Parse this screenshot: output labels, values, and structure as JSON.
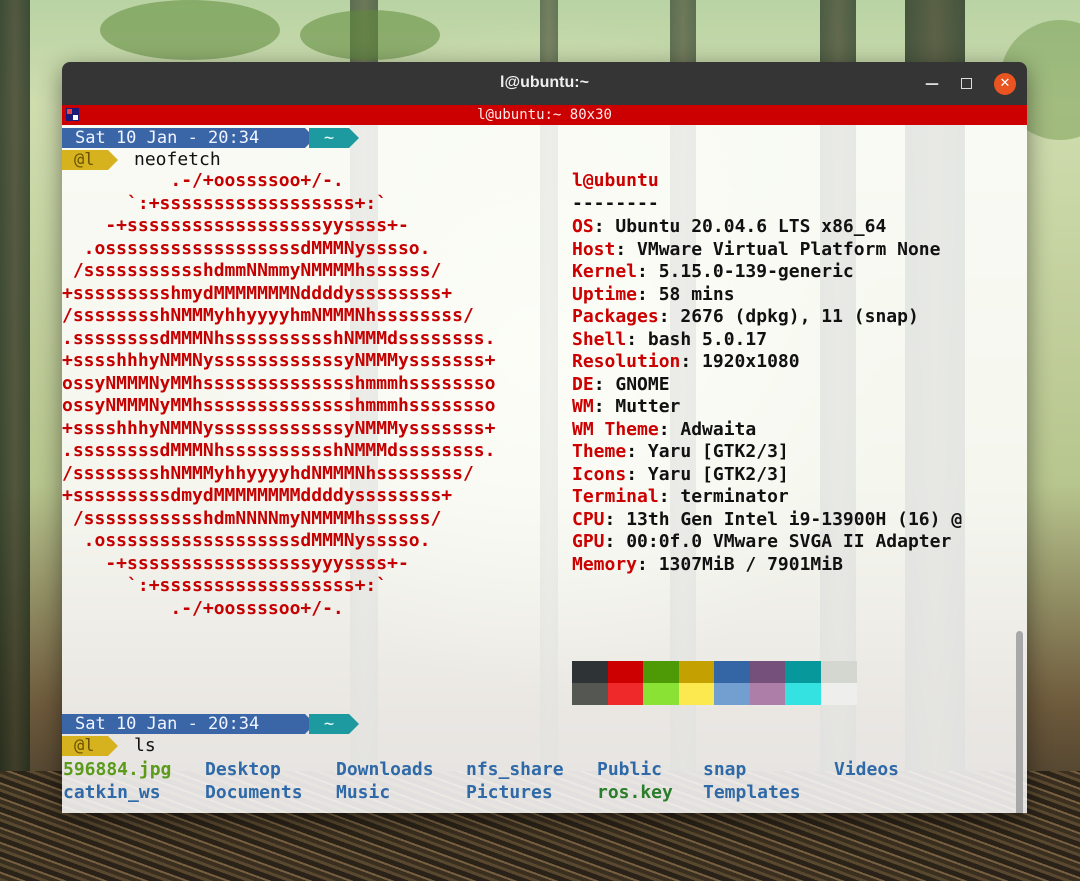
{
  "window": {
    "title": "l@ubuntu:~"
  },
  "terminal": {
    "title": "l@ubuntu:~ 80x30"
  },
  "prompt1": {
    "date": "Sat 10 Jan - 20:34",
    "dir": "~",
    "user": "@l",
    "command": "neofetch"
  },
  "prompt2": {
    "date": "Sat 10 Jan - 20:34",
    "dir": "~",
    "user": "@l",
    "command": "ls"
  },
  "logo_lines": [
    "          .-/+oossssoo+/-.",
    "      `:+ssssssssssssssssss+:`",
    "    -+ssssssssssssssssssyyssss+-",
    "  .ossssssssssssssssssdMMMNysssso.",
    " /ssssssssssshdmmNNmmyNMMMMhssssss/",
    "+ssssssssshmydMMMMMMMNddddyssssssss+",
    "/sssssssshNMMMyhhyyyyhmNMMMNhssssssss/",
    ".ssssssssdMMMNhsssssssssshNMMMdssssssss.",
    "+sssshhhyNMMNyssssssssssssyNMMMysssssss+",
    "ossyNMMMNyMMhsssssssssssssshmmmhssssssso",
    "ossyNMMMNyMMhsssssssssssssshmmmhssssssso",
    "+sssshhhyNMMNyssssssssssssyNMMMysssssss+",
    ".ssssssssdMMMNhsssssssssshNMMMdssssssss.",
    "/sssssssshNMMMyhhyyyyhdNMMMNhssssssss/",
    "+sssssssssdmydMMMMMMMMddddyssssssss+",
    " /ssssssssssshdmNNNNmyNMMMMhssssss/",
    "  .ossssssssssssssssssdMMMNysssso.",
    "    -+sssssssssssssssssyyyssss+-",
    "      `:+ssssssssssssssssss+:`",
    "          .-/+oossssoo+/-."
  ],
  "info": {
    "user_host": "l@ubuntu",
    "separator": "--------",
    "rows": [
      {
        "key": "OS",
        "value": "Ubuntu 20.04.6 LTS x86_64"
      },
      {
        "key": "Host",
        "value": "VMware Virtual Platform None"
      },
      {
        "key": "Kernel",
        "value": "5.15.0-139-generic"
      },
      {
        "key": "Uptime",
        "value": "58 mins"
      },
      {
        "key": "Packages",
        "value": "2676 (dpkg), 11 (snap)"
      },
      {
        "key": "Shell",
        "value": "bash 5.0.17"
      },
      {
        "key": "Resolution",
        "value": "1920x1080"
      },
      {
        "key": "DE",
        "value": "GNOME"
      },
      {
        "key": "WM",
        "value": "Mutter"
      },
      {
        "key": "WM Theme",
        "value": "Adwaita"
      },
      {
        "key": "Theme",
        "value": "Yaru [GTK2/3]"
      },
      {
        "key": "Icons",
        "value": "Yaru [GTK2/3]"
      },
      {
        "key": "Terminal",
        "value": "terminator"
      },
      {
        "key": "CPU",
        "value": "13th Gen Intel i9-13900H (16) @"
      },
      {
        "key": "GPU",
        "value": "00:0f.0 VMware SVGA II Adapter"
      },
      {
        "key": "Memory",
        "value": "1307MiB / 7901MiB"
      }
    ]
  },
  "palette": {
    "row1": [
      "#2e3436",
      "#cc0000",
      "#4e9a06",
      "#c4a000",
      "#3465a4",
      "#75507b",
      "#06989a",
      "#d3d7cf"
    ],
    "row2": [
      "#555753",
      "#ef2929",
      "#8ae234",
      "#fce94f",
      "#729fcf",
      "#ad7fa8",
      "#34e2e2",
      "#eeeeec"
    ]
  },
  "ls": {
    "row1": [
      {
        "name": "596884.jpg",
        "type": "image"
      },
      {
        "name": "Desktop",
        "type": "dir"
      },
      {
        "name": "Downloads",
        "type": "dir"
      },
      {
        "name": "nfs_share",
        "type": "dir"
      },
      {
        "name": "Public",
        "type": "dir"
      },
      {
        "name": "snap",
        "type": "dir"
      },
      {
        "name": "Videos",
        "type": "dir"
      }
    ],
    "row2": [
      {
        "name": "catkin_ws",
        "type": "dir"
      },
      {
        "name": "Documents",
        "type": "dir"
      },
      {
        "name": "Music",
        "type": "dir"
      },
      {
        "name": "Pictures",
        "type": "dir"
      },
      {
        "name": "ros.key",
        "type": "file"
      },
      {
        "name": "Templates",
        "type": "dir"
      }
    ]
  }
}
